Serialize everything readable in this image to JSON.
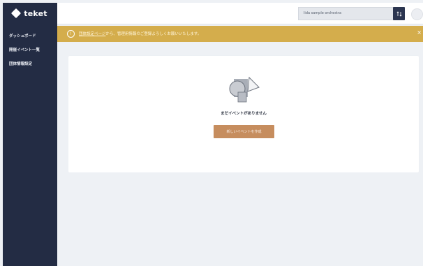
{
  "brand": {
    "name": "teket"
  },
  "sidebar": {
    "items": [
      {
        "label": "ダッシュボード"
      },
      {
        "label": "開催イベント一覧"
      },
      {
        "label": "団体情報設定"
      }
    ]
  },
  "header": {
    "organization": "lida sample orchestra"
  },
  "banner": {
    "icon": "!",
    "link_text": "団体設定ページ",
    "text": "から、管理用情報のご登録よろしくお願いいたします。",
    "close": "×"
  },
  "main": {
    "empty_message": "まだイベントがありません",
    "create_button": "新しいイベントを作成"
  },
  "colors": {
    "sidebar": "#232c44",
    "banner": "#d4ad4c",
    "button": "#c68d5e",
    "background": "#eef1f5"
  }
}
